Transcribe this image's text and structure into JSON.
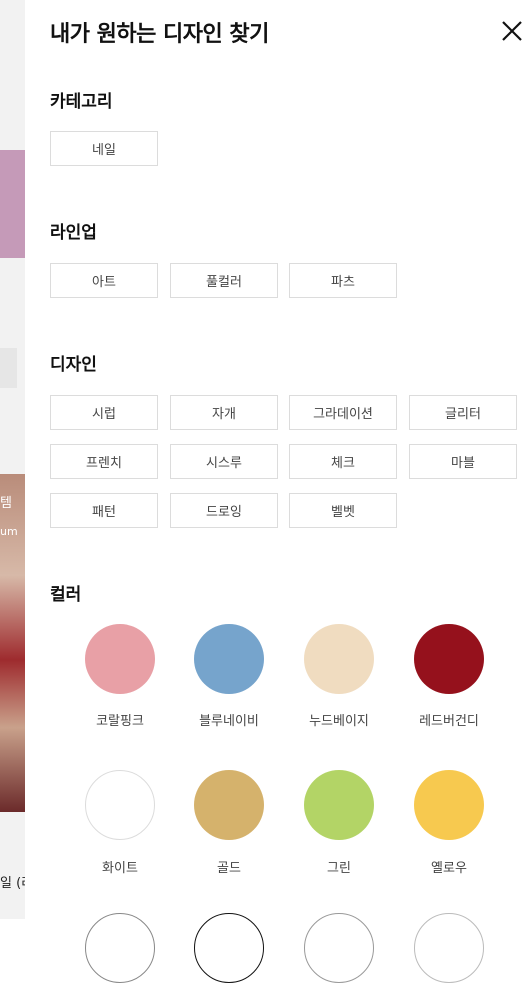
{
  "background": {
    "text1": "템",
    "text2": "um",
    "text3": "일 (리"
  },
  "panel": {
    "title": "내가 원하는 디자인 찾기"
  },
  "sections": {
    "category": {
      "title": "카테고리",
      "options": [
        "네일"
      ]
    },
    "lineup": {
      "title": "라인업",
      "options": [
        "아트",
        "풀컬러",
        "파츠"
      ]
    },
    "design": {
      "title": "디자인",
      "options": [
        "시럽",
        "자개",
        "그라데이션",
        "글리터",
        "프렌치",
        "시스루",
        "체크",
        "마블",
        "패턴",
        "드로잉",
        "벨벳"
      ]
    },
    "color": {
      "title": "컬러",
      "options": [
        {
          "label": "코랄핑크",
          "color": "#e8a0a6"
        },
        {
          "label": "블루네이비",
          "color": "#76a4cc"
        },
        {
          "label": "누드베이지",
          "color": "#f0dcc0"
        },
        {
          "label": "레드버건디",
          "color": "#95111c"
        },
        {
          "label": "화이트",
          "color": "#ffffff"
        },
        {
          "label": "골드",
          "color": "#d5b26c"
        },
        {
          "label": "그린",
          "color": "#b3d466"
        },
        {
          "label": "옐로우",
          "color": "#f7c94f"
        }
      ]
    }
  }
}
